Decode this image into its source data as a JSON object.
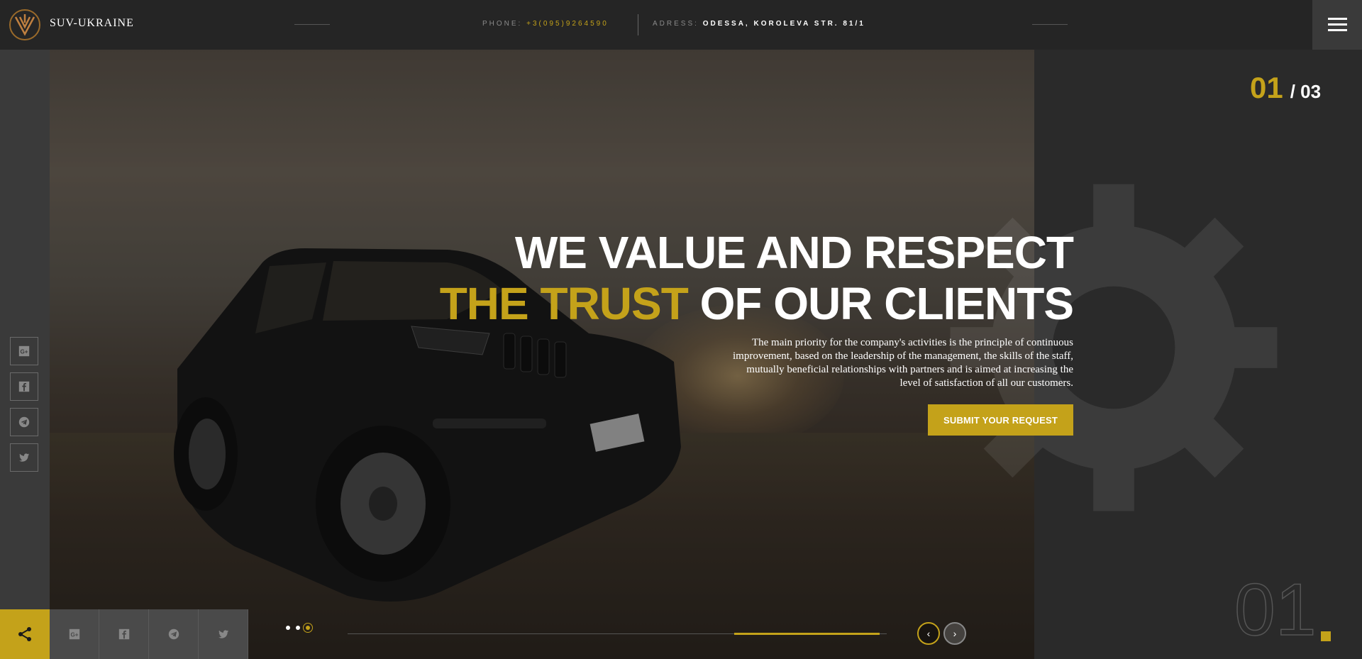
{
  "header": {
    "brand": "SUV-UKRAINE",
    "phone_label": "PHONE:",
    "phone_value": "+3(095)9264590",
    "address_label": "ADRESS:",
    "address_value": "ODESSA, KOROLEVA STR. 81/1",
    "menu_icon": "hamburger-icon"
  },
  "hero": {
    "headline_line1": "WE VALUE AND RESPECT",
    "headline_accent": "THE TRUST",
    "headline_line2_rest": " OF OUR CLIENTS",
    "description": "The main priority for the company's activities is the principle of continuous improvement, based on the leadership of the management, the skills of the staff, mutually beneficial relationships with partners and is aimed at increasing the level of satisfaction of all our customers.",
    "cta_label": "SUBMIT YOUR REQUEST"
  },
  "slider": {
    "current": "01",
    "total": "/ 03",
    "big_number": "01",
    "progress_fraction": 0.27,
    "prev_icon": "arrow-left-icon",
    "next_icon": "arrow-right-icon"
  },
  "rail_social": [
    "google-plus-icon",
    "facebook-icon",
    "telegram-icon",
    "twitter-icon"
  ],
  "share_bar": {
    "main_icon": "share-icon",
    "items": [
      "google-plus-icon",
      "facebook-icon",
      "telegram-icon",
      "twitter-icon"
    ]
  },
  "colors": {
    "accent": "#c4a21a",
    "dark": "#2a2a2a"
  }
}
